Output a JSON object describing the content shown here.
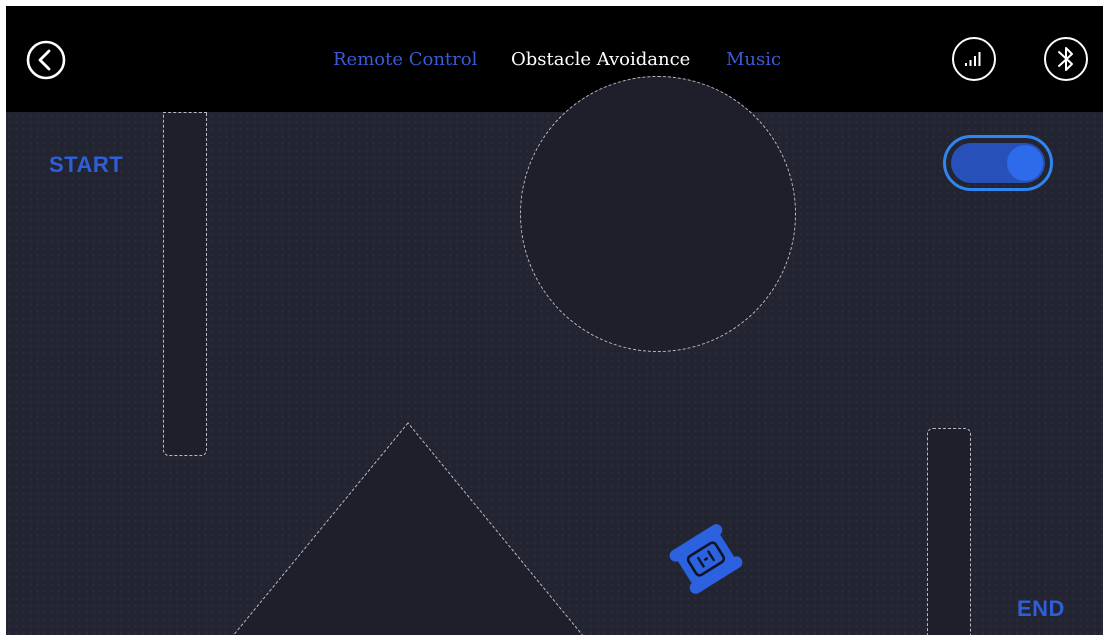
{
  "header": {
    "tabs": [
      {
        "label": "Remote Control",
        "active": false
      },
      {
        "label": "Obstacle Avoidance",
        "active": true
      },
      {
        "label": "Music",
        "active": false
      }
    ],
    "icons": {
      "back": "back-arrow-icon",
      "signal": "signal-strength-icon",
      "bluetooth": "bluetooth-icon"
    }
  },
  "field": {
    "start_label": "START",
    "end_label": "END",
    "toggle_on": true,
    "robot_icon": "robot-car-icon"
  },
  "colors": {
    "accent": "#2f5fd8",
    "header_bg": "#000000",
    "field_bg": "#232431",
    "toggle_border": "#2f86f0"
  }
}
